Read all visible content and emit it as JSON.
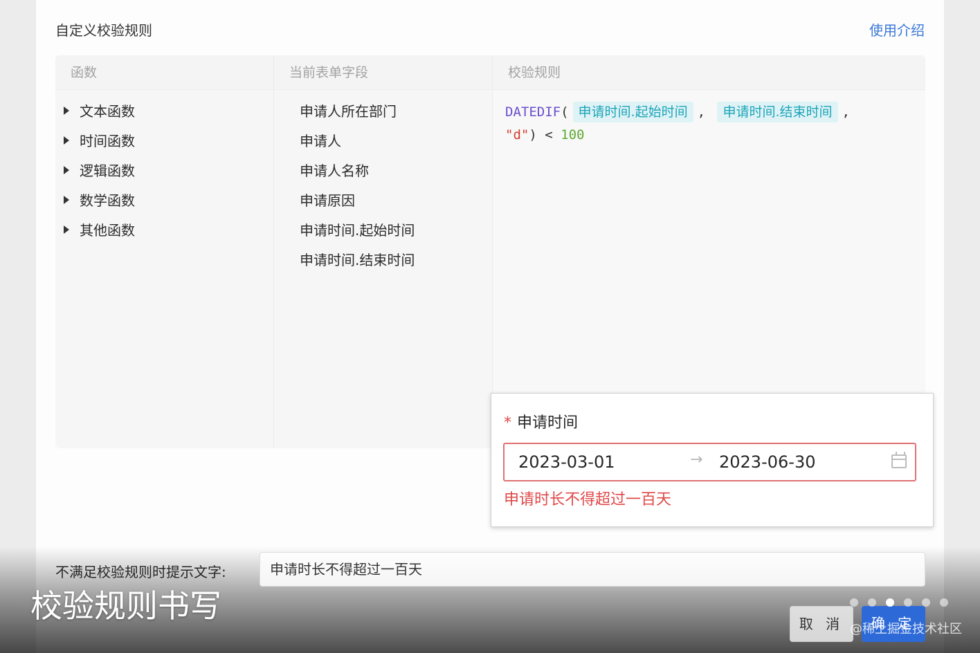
{
  "header": {
    "title": "自定义校验规则",
    "help_link": "使用介绍"
  },
  "columns": {
    "functions": "函数",
    "fields": "当前表单字段",
    "rule": "校验规则"
  },
  "functions": [
    "文本函数",
    "时间函数",
    "逻辑函数",
    "数学函数",
    "其他函数"
  ],
  "fields": [
    "申请人所在部门",
    "申请人",
    "申请人名称",
    "申请原因",
    "申请时间.起始时间",
    "申请时间.结束时间"
  ],
  "rule": {
    "func": "DATEDIF",
    "open_paren": "(",
    "field_start": "申请时间.起始时间",
    "comma1": ",",
    "field_end": "申请时间.结束时间",
    "comma2": ",",
    "unit": "\"d\"",
    "close_paren": ")",
    "operator": "<",
    "value": "100"
  },
  "popup": {
    "label": "申请时间",
    "required_mark": "*",
    "start_date": "2023-03-01",
    "range_arrow": "→",
    "end_date": "2023-06-30",
    "error": "申请时长不得超过一百天"
  },
  "hint": {
    "label": "不满足校验规则时提示文字:",
    "value": "申请时长不得超过一百天"
  },
  "buttons": {
    "cancel": "取 消",
    "ok": "确 定"
  },
  "caption": "校验规则书写",
  "watermark": "@稀土掘金技术社区",
  "carousel": {
    "count": 6,
    "active_index": 2
  }
}
